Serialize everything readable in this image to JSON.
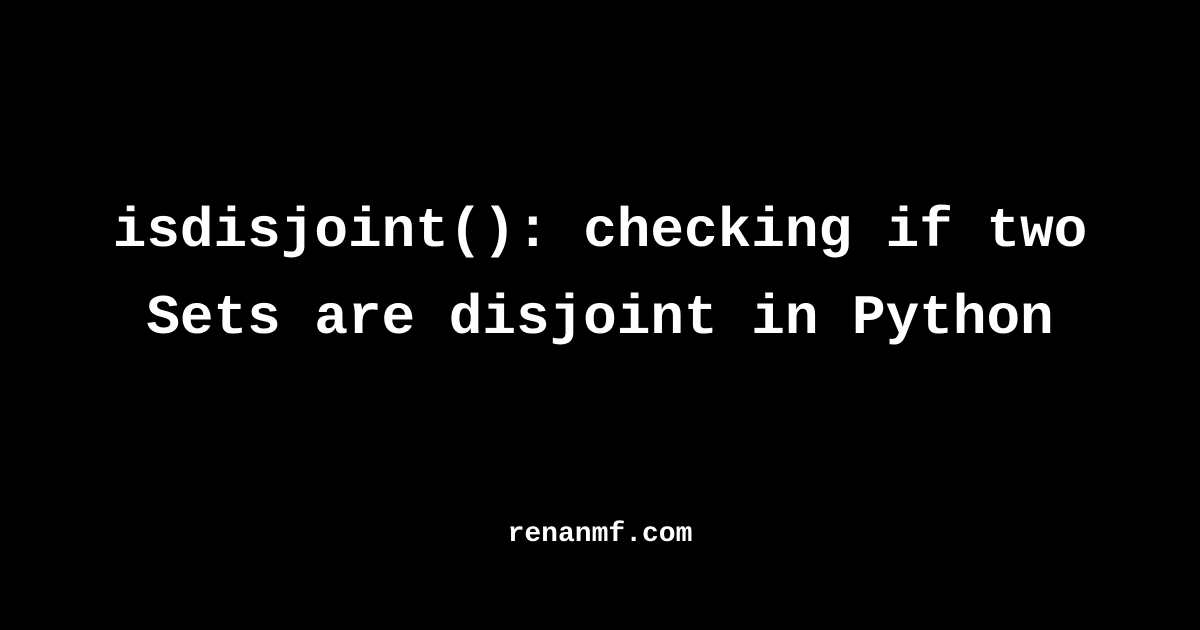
{
  "title": "isdisjoint(): checking if two Sets are disjoint in Python",
  "footer": "renanmf.com"
}
